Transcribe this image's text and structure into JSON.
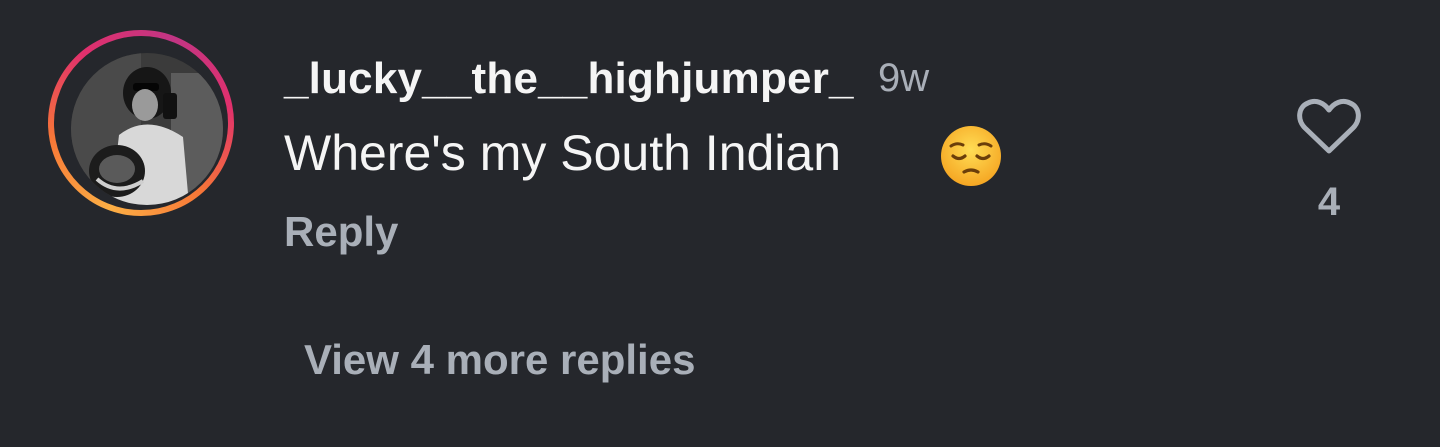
{
  "comment": {
    "username": "_lucky__the__highjumper_",
    "timestamp": "9w",
    "text": "Where's my South Indian",
    "emoji": "pensive-face",
    "reply_label": "Reply",
    "like_count": "4",
    "view_replies_label": "View 4 more replies"
  },
  "colors": {
    "background": "#25272c",
    "primary_text": "#f5f5f5",
    "secondary_text": "#a9afb8",
    "story_ring_start": "#fcaf45",
    "story_ring_end": "#e1306c"
  }
}
